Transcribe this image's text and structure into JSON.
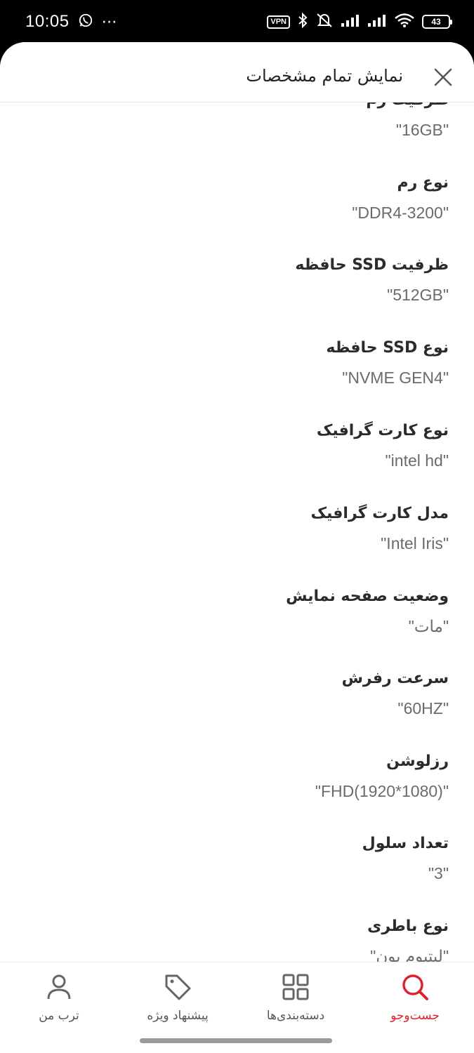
{
  "status_bar": {
    "time": "10:05",
    "more": "⋯",
    "vpn": "VPN",
    "battery": "43"
  },
  "header": {
    "title": "نمایش تمام مشخصات",
    "close_icon": "close-icon"
  },
  "specs": [
    {
      "label": "ظرفیت رم",
      "value": "\"16GB\""
    },
    {
      "label": "نوع رم",
      "value": "\"DDR4-3200\""
    },
    {
      "label": "ظرفیت SSD حافظه",
      "value": "\"512GB\""
    },
    {
      "label": "نوع SSD حافظه",
      "value": "\"NVME GEN4\""
    },
    {
      "label": "نوع کارت گرافیک",
      "value": "\"intel hd\""
    },
    {
      "label": "مدل کارت گرافیک",
      "value": "\"Intel Iris\""
    },
    {
      "label": "وضعیت صفحه نمایش",
      "value": "\"مات\""
    },
    {
      "label": "سرعت رفرش",
      "value": "\"60HZ\""
    },
    {
      "label": "رزلوشن",
      "value": "\"FHD(1920*1080)\""
    },
    {
      "label": "تعداد سلول",
      "value": "\"3\""
    },
    {
      "label": "نوع باطری",
      "value": "\"لیتیوم یون\""
    }
  ],
  "bottom_nav": {
    "items": [
      {
        "label": "جست‌وجو",
        "icon": "search-icon",
        "active": true
      },
      {
        "label": "دسته‌بندی‌ها",
        "icon": "grid-icon",
        "active": false
      },
      {
        "label": "پیشنهاد ویژه",
        "icon": "tag-icon",
        "active": false
      },
      {
        "label": "ترب من",
        "icon": "user-icon",
        "active": false
      }
    ]
  },
  "colors": {
    "accent": "#e0202f",
    "label_text": "#2b2b2b",
    "value_text": "#6b6b6b"
  }
}
